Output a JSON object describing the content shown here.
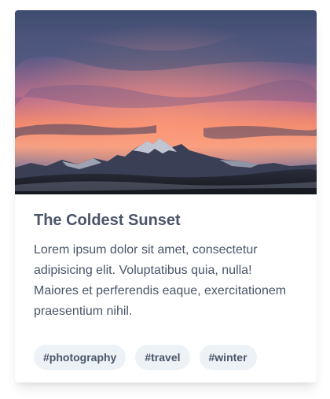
{
  "card": {
    "image_alt": "Sunset in the mountains",
    "title": "The Coldest Sunset",
    "description": "Lorem ipsum dolor sit amet, consectetur adipisicing elit. Voluptatibus quia, nulla! Maiores et perferendis eaque, exercitationem praesentium nihil.",
    "tags": [
      "#photography",
      "#travel",
      "#winter"
    ]
  },
  "colors": {
    "text": "#4a5568",
    "tag_background": "#edf2f7",
    "card_background": "#ffffff"
  }
}
